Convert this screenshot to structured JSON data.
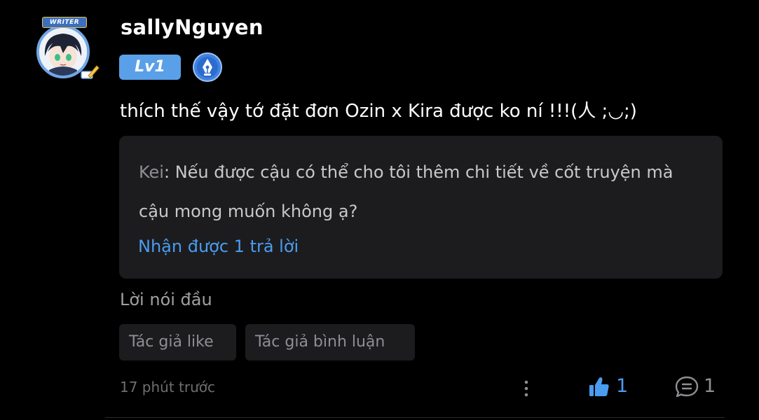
{
  "user": {
    "name": "sallyNguyen",
    "avatar_badge": "WRITER",
    "level": "Lv1",
    "writer_icon": "fountain-pen-icon"
  },
  "comment": {
    "text": "thích thế vậy tớ đặt đơn Ozin x Kira được ko ní !!!(人 ;◡;)"
  },
  "reply": {
    "author": "Kei",
    "separator": ": ",
    "text": "Nếu được cậu có thể cho tôi thêm chi tiết về cốt truyện mà cậu mong muốn không ạ?",
    "more_label": "Nhận được 1 trả lời"
  },
  "preface": "Lời nói đầu",
  "tags": {
    "author_like": "Tác giả like",
    "author_comment": "Tác giả bình luận"
  },
  "footer": {
    "timestamp": "17 phút trước",
    "likes": "1",
    "comments": "1"
  },
  "colors": {
    "accent": "#4a9cf0",
    "background": "#000000",
    "card": "#1c1c1e",
    "level_badge": "#5aa0e8"
  }
}
